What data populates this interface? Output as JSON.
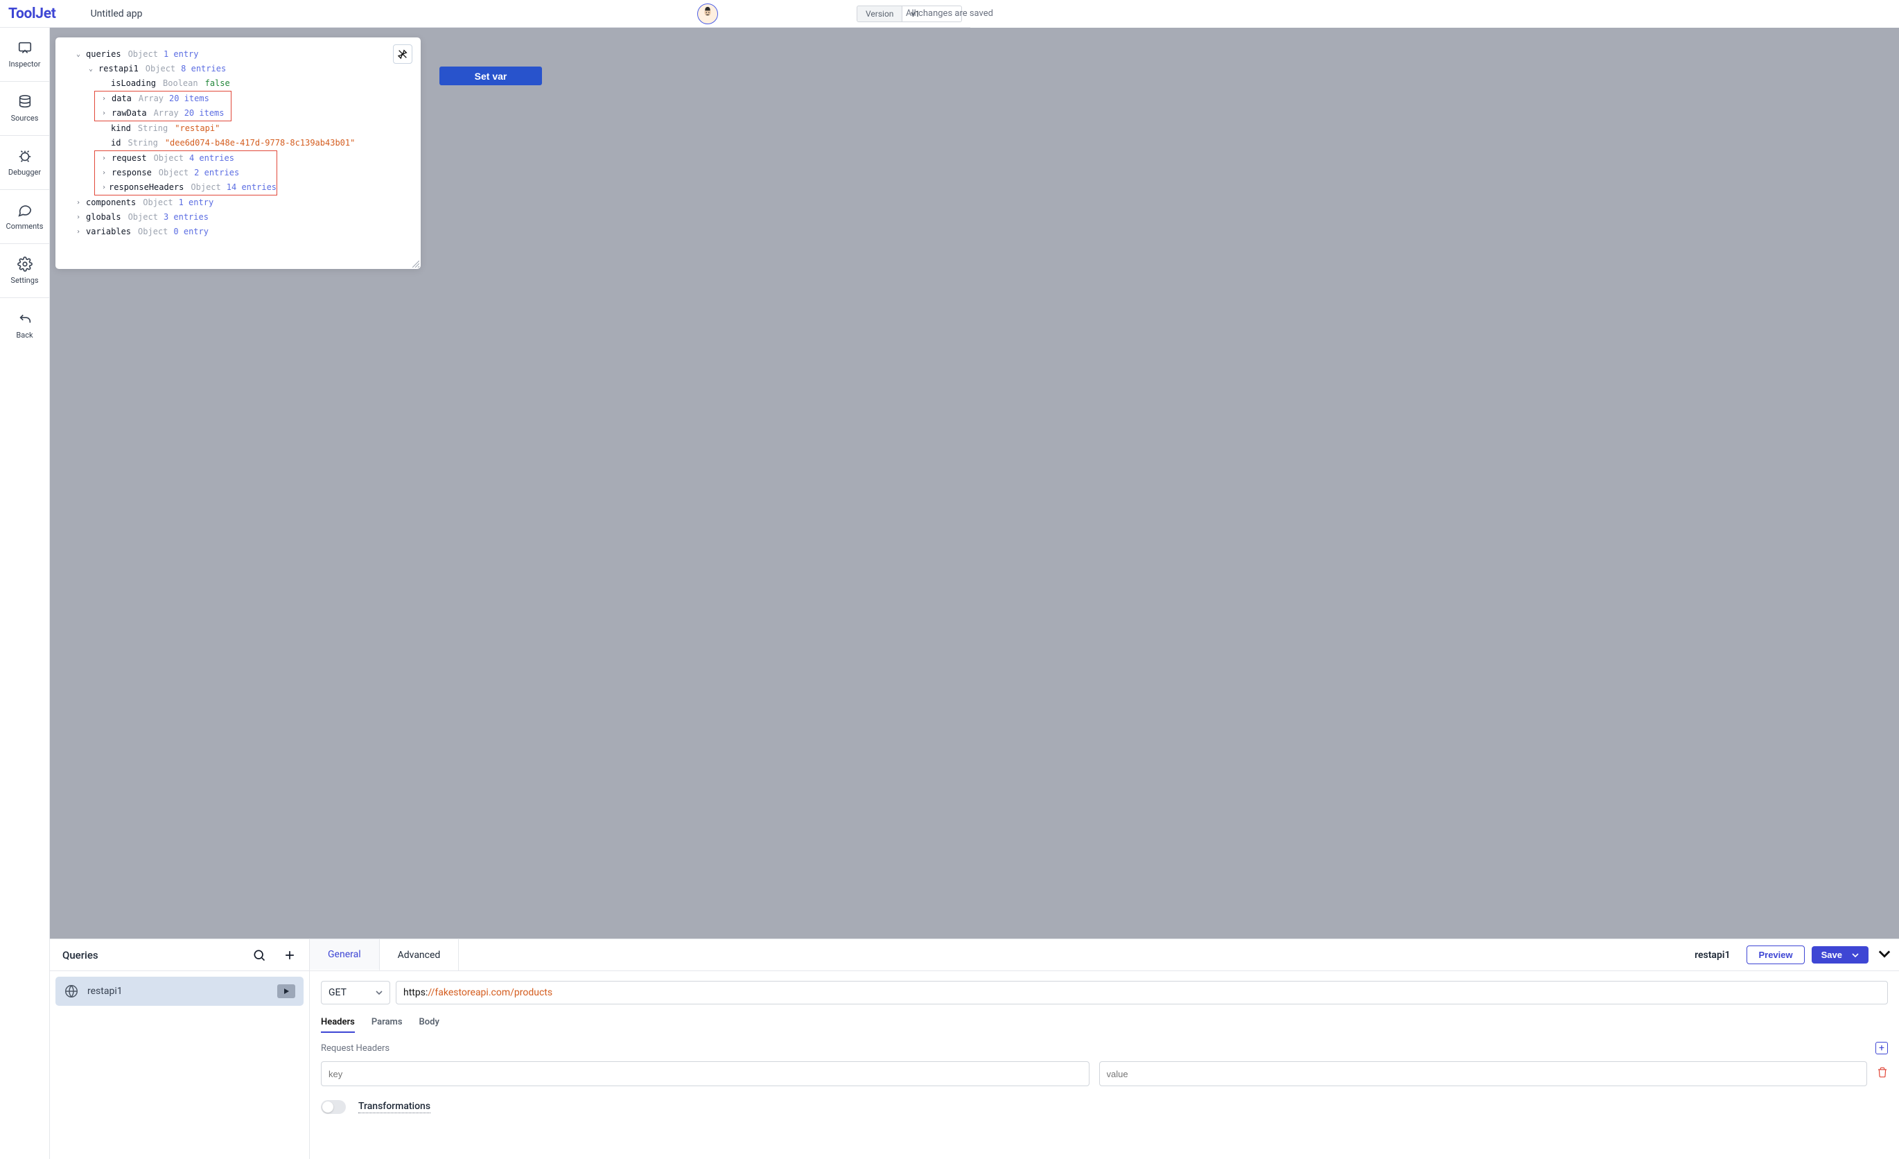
{
  "header": {
    "logo": "ToolJet",
    "app_title": "Untitled app",
    "save_status": "All changes are saved",
    "version_label": "Version",
    "version_value": "v1"
  },
  "rail": {
    "inspector": "Inspector",
    "sources": "Sources",
    "debugger": "Debugger",
    "comments": "Comments",
    "settings": "Settings",
    "back": "Back"
  },
  "canvas": {
    "set_var_btn": "Set var"
  },
  "inspector": {
    "rows": {
      "queries": {
        "key": "queries",
        "type": "Object",
        "meta": "1 entry"
      },
      "restapi1": {
        "key": "restapi1",
        "type": "Object",
        "meta": "8 entries"
      },
      "isLoading": {
        "key": "isLoading",
        "type": "Boolean",
        "value": "false"
      },
      "data": {
        "key": "data",
        "type": "Array",
        "meta": "20 items"
      },
      "rawData": {
        "key": "rawData",
        "type": "Array",
        "meta": "20 items"
      },
      "kind": {
        "key": "kind",
        "type": "String",
        "value": "\"restapi\""
      },
      "id": {
        "key": "id",
        "type": "String",
        "value": "\"dee6d074-b48e-417d-9778-8c139ab43b01\""
      },
      "request": {
        "key": "request",
        "type": "Object",
        "meta": "4 entries"
      },
      "response": {
        "key": "response",
        "type": "Object",
        "meta": "2 entries"
      },
      "responseHeaders": {
        "key": "responseHeaders",
        "type": "Object",
        "meta": "14 entries"
      },
      "components": {
        "key": "components",
        "type": "Object",
        "meta": "1 entry"
      },
      "globals": {
        "key": "globals",
        "type": "Object",
        "meta": "3 entries"
      },
      "variables": {
        "key": "variables",
        "type": "Object",
        "meta": "0 entry"
      }
    }
  },
  "queries": {
    "panel_title": "Queries",
    "item_name": "restapi1"
  },
  "editor": {
    "tab_general": "General",
    "tab_advanced": "Advanced",
    "query_name": "restapi1",
    "preview_btn": "Preview",
    "save_btn": "Save",
    "method": "GET",
    "url_proto": "https:",
    "url_rest": "//fakestoreapi.com/products",
    "subtabs": {
      "headers": "Headers",
      "params": "Params",
      "body": "Body"
    },
    "request_headers_label": "Request Headers",
    "kv_key_placeholder": "key",
    "kv_val_placeholder": "value",
    "transformations_label": "Transformations"
  }
}
